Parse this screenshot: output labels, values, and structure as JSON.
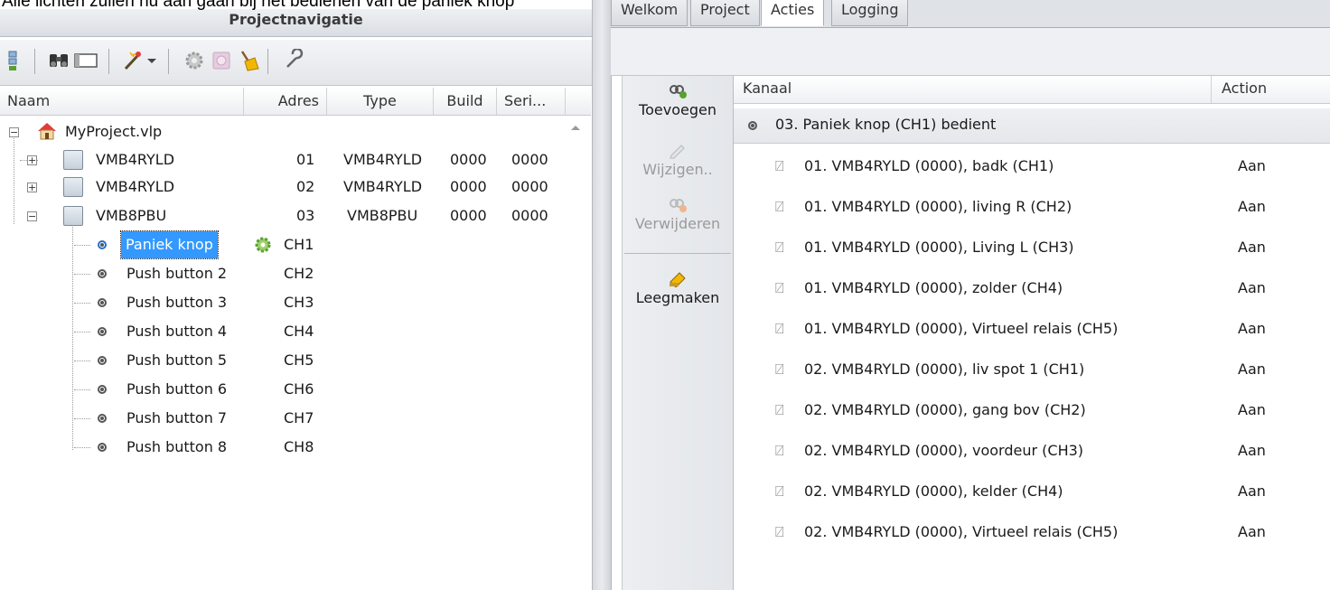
{
  "caption": "Alle lichten zullen nu aan gaan bij het bedienen van de paniek knop",
  "left_panel": {
    "title": "Projectnavigatie",
    "toolbar_icons": [
      "add-module-icon",
      "binoculars-icon",
      "window-icon",
      "magic-wand-icon",
      "dropdown-arrow-icon",
      "gear-icon",
      "disabled-plus-icon",
      "broom-icon",
      "wrench-icon"
    ],
    "columns": [
      "Naam",
      "Adres",
      "Type",
      "Build",
      "Seri..."
    ],
    "project": "MyProject.vlp",
    "modules": [
      {
        "name": "VMB4RYLD",
        "address": "01",
        "type": "VMB4RYLD",
        "build": "0000",
        "serial": "0000",
        "expander": "+"
      },
      {
        "name": "VMB4RYLD",
        "address": "02",
        "type": "VMB4RYLD",
        "build": "0000",
        "serial": "0000",
        "expander": "+"
      },
      {
        "name": "VMB8PBU",
        "address": "03",
        "type": "VMB8PBU",
        "build": "0000",
        "serial": "0000",
        "expander": "−"
      }
    ],
    "channels": [
      {
        "name": "Paniek knop",
        "channel": "CH1"
      },
      {
        "name": "Push button 2",
        "channel": "CH2"
      },
      {
        "name": "Push button 3",
        "channel": "CH3"
      },
      {
        "name": "Push button 4",
        "channel": "CH4"
      },
      {
        "name": "Push button 5",
        "channel": "CH5"
      },
      {
        "name": "Push button 6",
        "channel": "CH6"
      },
      {
        "name": "Push button 7",
        "channel": "CH7"
      },
      {
        "name": "Push button 8",
        "channel": "CH8"
      }
    ]
  },
  "tabs": [
    "Welkom",
    "Project",
    "Acties",
    "Logging"
  ],
  "actions_panel": {
    "add_label": "Toevoegen",
    "edit_label": "Wijzigen..",
    "delete_label": "Verwijderen",
    "clear_label": "Leegmaken"
  },
  "list": {
    "columns": {
      "channel": "Kanaal",
      "action": "Action"
    },
    "group": "03. Paniek knop (CH1) bedient",
    "rows": [
      {
        "channel": "01. VMB4RYLD (0000), badk (CH1)",
        "action": "Aan"
      },
      {
        "channel": "01. VMB4RYLD (0000), living R (CH2)",
        "action": "Aan"
      },
      {
        "channel": "01. VMB4RYLD (0000), Living L (CH3)",
        "action": "Aan"
      },
      {
        "channel": "01. VMB4RYLD (0000), zolder (CH4)",
        "action": "Aan"
      },
      {
        "channel": "01. VMB4RYLD (0000), Virtueel relais (CH5)",
        "action": "Aan"
      },
      {
        "channel": "02. VMB4RYLD (0000), liv spot 1 (CH1)",
        "action": "Aan"
      },
      {
        "channel": "02. VMB4RYLD (0000), gang bov (CH2)",
        "action": "Aan"
      },
      {
        "channel": "02. VMB4RYLD (0000), voordeur (CH3)",
        "action": "Aan"
      },
      {
        "channel": "02. VMB4RYLD (0000), kelder (CH4)",
        "action": "Aan"
      },
      {
        "channel": "02. VMB4RYLD (0000), Virtueel relais (CH5)",
        "action": "Aan"
      }
    ]
  },
  "colors": {
    "selection": "#3399ff",
    "panel_bg": "#eef0f3",
    "accent_green": "#5aa02c"
  }
}
